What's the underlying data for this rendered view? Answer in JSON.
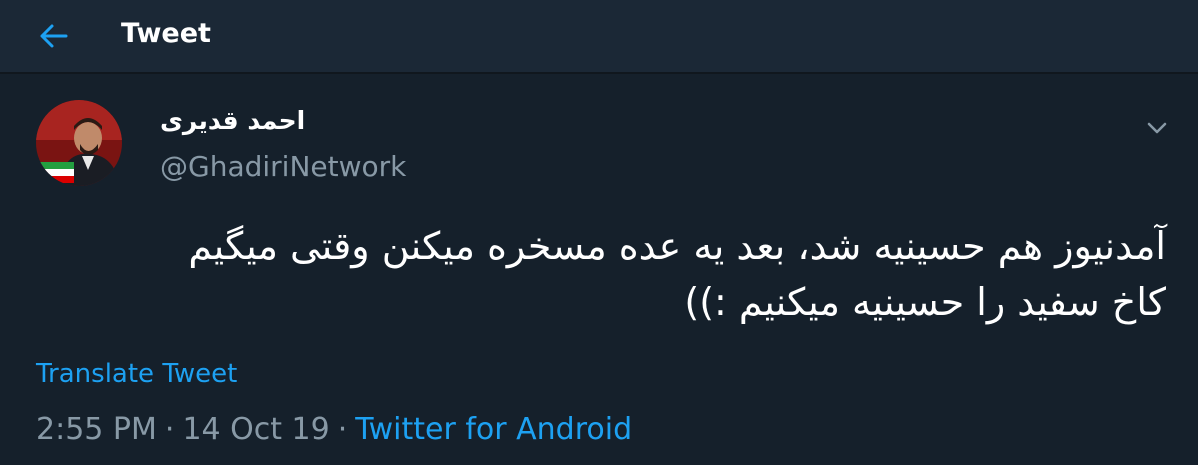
{
  "header": {
    "title": "Tweet",
    "back_icon": "arrow-left-icon"
  },
  "tweet": {
    "author": {
      "display_name": "احمد قدیری",
      "handle": "@GhadiriNetwork",
      "avatar": "avatar"
    },
    "menu_icon": "chevron-down-icon",
    "text": "آمدنیوز هم حسینیه شد، بعد یه عده مسخره میکنن وقتی میگیم\nکاخ سفید را حسینیه میکنیم :))",
    "translate_label": "Translate Tweet",
    "time": "2:55 PM",
    "date": "14 Oct 19",
    "separator": "·",
    "source": "Twitter for Android"
  },
  "colors": {
    "background": "#15202b",
    "header_bg": "#1b2836",
    "accent": "#1da1f2",
    "secondary_text": "#8899a6"
  }
}
